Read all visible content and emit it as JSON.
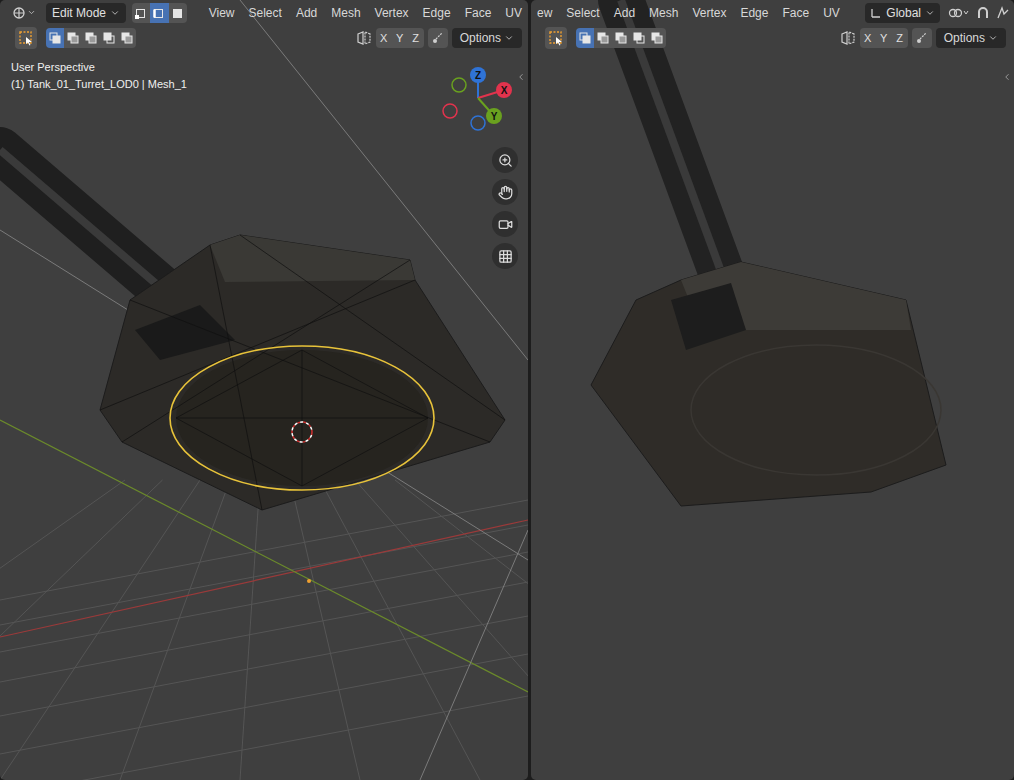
{
  "left_view": {
    "editor_mode": "Edit Mode",
    "select_modes": [
      {
        "mode": "vertex",
        "selected": false
      },
      {
        "mode": "edge",
        "selected": true
      },
      {
        "mode": "face",
        "selected": false
      }
    ],
    "menus": [
      "View",
      "Select",
      "Add",
      "Mesh",
      "Vertex",
      "Edge",
      "Face",
      "UV"
    ],
    "select_boxes": [
      {
        "mode": "set",
        "selected": true
      },
      {
        "mode": "extend",
        "selected": false
      },
      {
        "mode": "subtract",
        "selected": false
      },
      {
        "mode": "invert",
        "selected": false
      },
      {
        "mode": "intersect",
        "selected": false
      }
    ],
    "axes": [
      {
        "label": "X",
        "selected": false
      },
      {
        "label": "Y",
        "selected": false
      },
      {
        "label": "Z",
        "selected": false
      }
    ],
    "options": "Options",
    "view_name": "User Perspective",
    "object_info": "(1) Tank_01_Turret_LOD0 | Mesh_1",
    "gizmo": [
      {
        "label": "Z",
        "color": "#2f73d6"
      },
      {
        "label": "X",
        "color": "#e2334d"
      },
      {
        "label": "Y",
        "color": "#6aa11f"
      }
    ],
    "show_wireframe": true
  },
  "right_view": {
    "menus": [
      "ew",
      "Select",
      "Add",
      "Mesh",
      "Vertex",
      "Edge",
      "Face",
      "UV"
    ],
    "orientation": "Global",
    "select_boxes": [
      {
        "mode": "set",
        "selected": true
      },
      {
        "mode": "extend",
        "selected": false
      },
      {
        "mode": "subtract",
        "selected": false
      },
      {
        "mode": "invert",
        "selected": false
      },
      {
        "mode": "intersect",
        "selected": false
      }
    ],
    "axes": [
      {
        "label": "X",
        "selected": false
      },
      {
        "label": "Y",
        "selected": false
      },
      {
        "label": "Z",
        "selected": false
      }
    ],
    "options": "Options",
    "show_wireframe": false
  }
}
